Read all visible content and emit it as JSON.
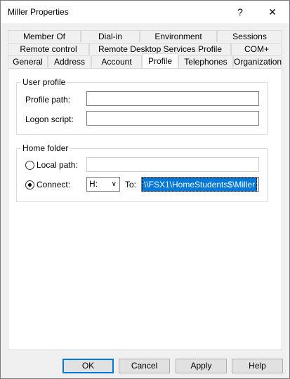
{
  "window": {
    "title": "Miller Properties",
    "help_glyph": "?",
    "close_glyph": "✕"
  },
  "tabs": {
    "row1": [
      "Member Of",
      "Dial-in",
      "Environment",
      "Sessions"
    ],
    "row2": [
      "Remote control",
      "Remote Desktop Services Profile",
      "COM+"
    ],
    "row3": [
      "General",
      "Address",
      "Account",
      "Profile",
      "Telephones",
      "Organization"
    ],
    "active": "Profile"
  },
  "user_profile": {
    "group_label": "User profile",
    "profile_path_label": "Profile path:",
    "profile_path_value": "",
    "logon_script_label": "Logon script:",
    "logon_script_value": ""
  },
  "home_folder": {
    "group_label": "Home folder",
    "local_path_label": "Local path:",
    "local_path_value": "",
    "connect_label": "Connect:",
    "drive_value": "H:",
    "to_label": "To:",
    "to_value": "\\\\FSX1\\HomeStudents$\\Miller",
    "selected_option": "connect"
  },
  "buttons": {
    "ok": "OK",
    "cancel": "Cancel",
    "apply": "Apply",
    "help": "Help"
  }
}
